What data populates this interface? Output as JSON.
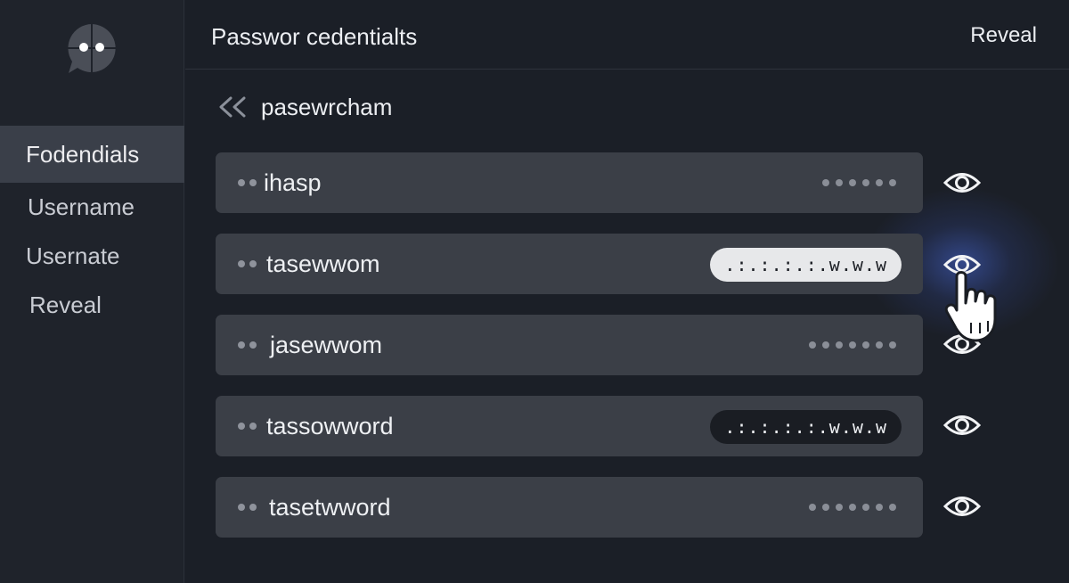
{
  "header": {
    "title": "Passwor cedentialts",
    "reveal_label": "Reveal"
  },
  "sidebar": {
    "logo_icon": "chat-bubble-logo",
    "items": [
      {
        "label": "Fodendials",
        "active": true
      },
      {
        "label": "Username"
      },
      {
        "label": "Usernate"
      },
      {
        "label": "Reveal"
      }
    ]
  },
  "back": {
    "icon": "double-chevron-left-icon",
    "label": "pasewrcham"
  },
  "rows": [
    {
      "name": "ihasp",
      "masked": "••••••",
      "pill": null,
      "eye_icon": "eye-icon"
    },
    {
      "name": "tasewwom",
      "pill": {
        "text": ".:.:.:.:.w.w.w",
        "style": "light"
      },
      "eye_icon": "eye-icon",
      "highlighted": true
    },
    {
      "name": "jasewwom",
      "masked": "•••••••",
      "pill": null,
      "eye_icon": "eye-icon"
    },
    {
      "name": "tassowword",
      "pill": {
        "text": ".:.:.:.:.w.w.w",
        "style": "dark"
      },
      "eye_icon": "eye-icon"
    },
    {
      "name": "tasetwword",
      "masked": "•••••••",
      "pill": null,
      "eye_icon": "eye-icon"
    }
  ],
  "colors": {
    "background": "#1b1f27",
    "row": "#3b3f47",
    "accent_glow": "#5078ff"
  }
}
